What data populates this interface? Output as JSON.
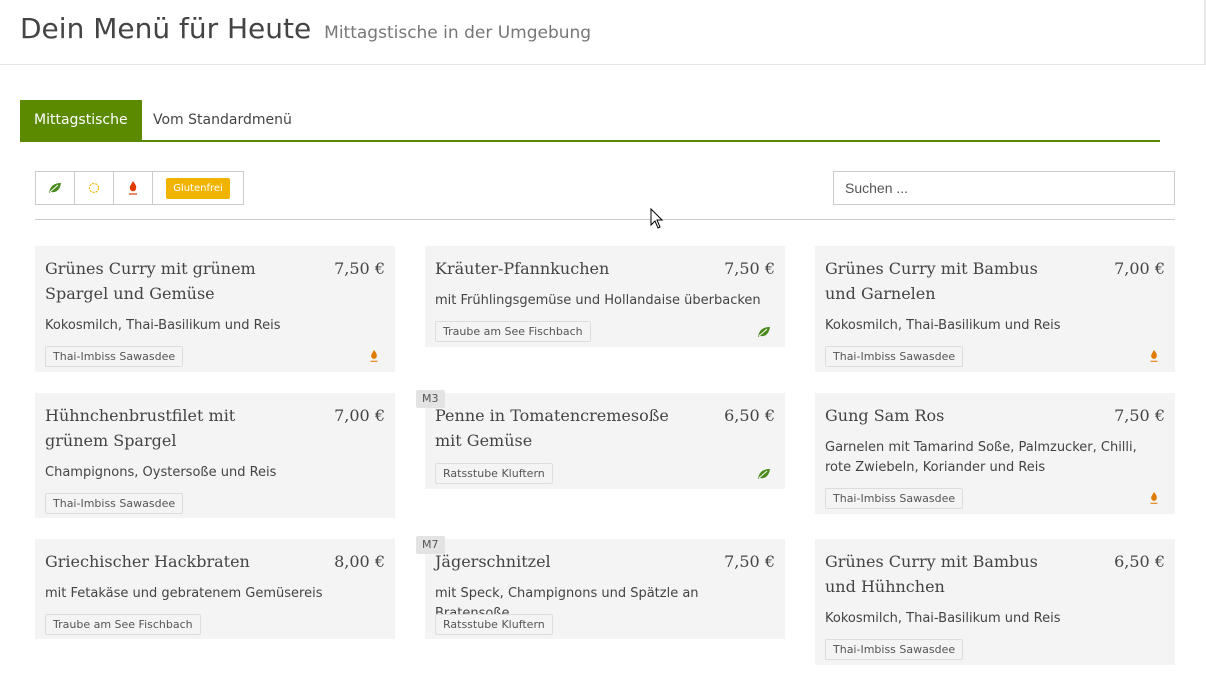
{
  "header": {
    "title": "Dein Menü für Heute",
    "subtitle": "Mittagstische in der Umgebung"
  },
  "tabs": [
    {
      "label": "Mittagstische",
      "active": true
    },
    {
      "label": "Vom Standardmenü",
      "active": false
    }
  ],
  "filters": {
    "vegetarian_icon": "leaf-icon",
    "vegan_icon": "sun-icon",
    "spicy_icon": "flame-icon",
    "gluten_label": "Glutenfrei"
  },
  "search": {
    "placeholder": "Suchen ..."
  },
  "colors": {
    "accent": "#5b8a00",
    "gluten": "#f0b400",
    "leaf": "#4a8a1c",
    "flame": "#e07b00"
  },
  "dishes": [
    {
      "name": "Grünes Curry mit grünem Spargel und Gemüse",
      "price": "7,50 €",
      "description": "Kokosmilch, Thai-Basilikum und Reis",
      "restaurant": "Thai-Imbiss Sawasdee",
      "icon": "flame-icon"
    },
    {
      "name": "Kräuter-Pfannkuchen",
      "price": "7,50 €",
      "description": "mit Frühlingsgemüse und Hollandaise überbacken",
      "restaurant": "Traube am See Fischbach",
      "icon": "leaf-icon"
    },
    {
      "name": "Grünes Curry mit Bambus und Garnelen",
      "price": "7,00 €",
      "description": "Kokosmilch, Thai-Basilikum und Reis",
      "restaurant": "Thai-Imbiss Sawasdee",
      "icon": "flame-icon"
    },
    {
      "name": "Hühnchenbrustfilet mit grünem Spargel",
      "price": "7,00 €",
      "description": "Champignons, Oystersoße und Reis",
      "restaurant": "Thai-Imbiss Sawasdee",
      "icon": ""
    },
    {
      "name": "Penne in Tomatencremesoße mit Gemüse",
      "price": "6,50 €",
      "description": "",
      "restaurant": "Ratsstube Kluftern",
      "icon": "leaf-icon",
      "badge": "M3"
    },
    {
      "name": "Gung Sam Ros",
      "price": "7,50 €",
      "description": "Garnelen mit Tamarind Soße, Palmzucker, Chilli, rote Zwiebeln, Koriander und Reis",
      "restaurant": "Thai-Imbiss Sawasdee",
      "icon": "flame-icon"
    },
    {
      "name": "Griechischer Hackbraten",
      "price": "8,00 €",
      "description": "mit Fetakäse und gebratenem Gemüsereis",
      "restaurant": "Traube am See Fischbach",
      "icon": ""
    },
    {
      "name": "Jägerschnitzel",
      "price": "7,50 €",
      "description": "mit Speck, Champignons und Spätzle an Bratensoße",
      "restaurant": "Ratsstube Kluftern",
      "icon": "",
      "badge": "M7"
    },
    {
      "name": "Grünes Curry mit Bambus und Hühnchen",
      "price": "6,50 €",
      "description": "Kokosmilch, Thai-Basilikum und Reis",
      "restaurant": "Thai-Imbiss Sawasdee",
      "icon": ""
    }
  ]
}
